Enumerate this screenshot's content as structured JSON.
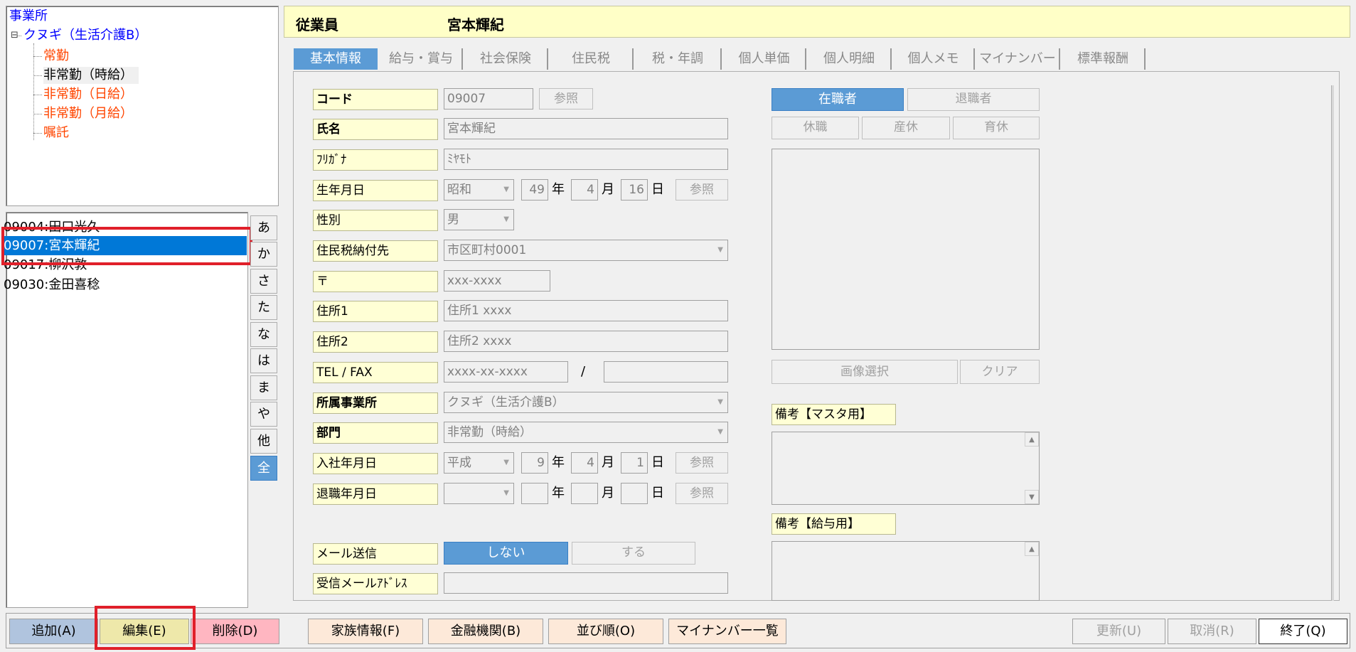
{
  "tree": {
    "root": "事業所",
    "facility": "クヌギ（生活介護B）",
    "toggle": "⊟",
    "departments": [
      "常勤",
      "非常勤（時給）",
      "非常勤（日給）",
      "非常勤（月給）",
      "嘱託"
    ]
  },
  "employees": [
    "09004:田口光久",
    "09007:宮本輝紀",
    "09017:柳沢敦",
    "09030:金田喜稔"
  ],
  "kana_index": [
    "あ",
    "か",
    "さ",
    "た",
    "な",
    "は",
    "ま",
    "や",
    "他",
    "全"
  ],
  "header": {
    "label": "従業員",
    "name": "宮本輝紀"
  },
  "tabs": [
    "基本情報",
    "給与・賞与",
    "社会保険",
    "住民税",
    "税・年調",
    "個人単価",
    "個人明細",
    "個人メモ",
    "マイナンバー",
    "標準報酬"
  ],
  "form": {
    "code_label": "コード",
    "code_value": "09007",
    "ref_button": "参照",
    "name_label": "氏名",
    "name_value": "宮本輝紀",
    "kana_label": "ﾌﾘｶﾞﾅ",
    "kana_value": "ﾐﾔﾓﾄ",
    "birth_label": "生年月日",
    "birth_era": "昭和",
    "birth_year": "49",
    "birth_month": "4",
    "birth_day": "16",
    "year_unit": "年",
    "month_unit": "月",
    "day_unit": "日",
    "gender_label": "性別",
    "gender_value": "男",
    "tax_label": "住民税納付先",
    "tax_value": "市区町村0001",
    "postal_label": "〒",
    "postal_value": "xxx-xxxx",
    "addr1_label": "住所1",
    "addr1_value": "住所1 xxxx",
    "addr2_label": "住所2",
    "addr2_value": "住所2 xxxx",
    "tel_label": "TEL / FAX",
    "tel_value": "xxxx-xx-xxxx",
    "tel_sep": "/",
    "fax_value": "",
    "office_label": "所属事業所",
    "office_value": "クヌギ（生活介護B）",
    "dept_label": "部門",
    "dept_value": "非常勤（時給）",
    "hire_label": "入社年月日",
    "hire_era": "平成",
    "hire_year": "9",
    "hire_month": "4",
    "hire_day": "1",
    "retire_label": "退職年月日",
    "retire_era": "",
    "retire_year": "",
    "retire_month": "",
    "retire_day": "",
    "mail_label": "メール送信",
    "mail_off": "しない",
    "mail_on": "する",
    "mailaddr_label": "受信メールｱﾄﾞﾚｽ",
    "mailaddr_value": ""
  },
  "status": {
    "active": "在職者",
    "retired": "退職者",
    "leave": "休職",
    "maternity": "産休",
    "childcare": "育休",
    "image_select": "画像選択",
    "clear": "クリア",
    "memo_master_label": "備考【マスタ用】",
    "memo_salary_label": "備考【給与用】"
  },
  "bottom": {
    "add": "追加(A)",
    "edit": "編集(E)",
    "delete": "削除(D)",
    "family": "家族情報(F)",
    "bank": "金融機関(B)",
    "order": "並び順(O)",
    "mynumber_list": "マイナンバー一覧",
    "update": "更新(U)",
    "cancel": "取消(R)",
    "exit": "終了(Q)"
  },
  "colors": {
    "accent": "#5b9bd5",
    "selected": "#0078d7",
    "label_bg": "#ffffd5",
    "dept_text": "#ff4500",
    "tree_link": "#0000ff"
  }
}
